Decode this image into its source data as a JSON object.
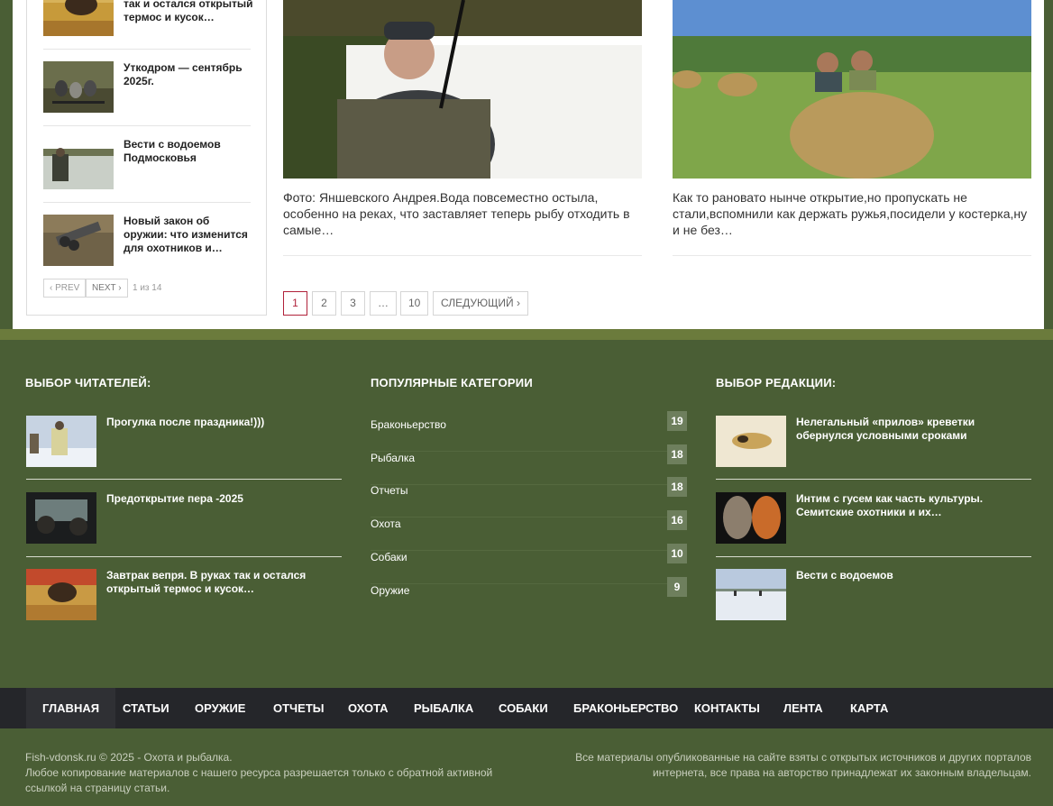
{
  "sidebar": {
    "items": [
      {
        "title": "так и остался открытый термос и кусок…"
      },
      {
        "title": "Уткодром — сентябрь 2025г."
      },
      {
        "title": "Вести с водоемов Подмосковья"
      },
      {
        "title": "Новый закон об оружии: что изменится для охотников и…"
      }
    ],
    "prev_label": "PREV",
    "next_label": "NEXT",
    "page_info": "1 из 14"
  },
  "articles": [
    {
      "excerpt": "Фото: Яншевского Андрея.Вода повсеместно остыла, особенно на реках, что заставляет теперь рыбу отходить в самые…"
    },
    {
      "excerpt": "Как то рановато нынче открытие,но пропускать не стали,вспомнили как держать ружья,посидели у костерка,ну и не без…"
    }
  ],
  "pagination": {
    "pages": [
      "1",
      "2",
      "3",
      "…",
      "10"
    ],
    "next_label": "СЛЕДУЮЩИЙ"
  },
  "footer": {
    "readers": {
      "heading": "ВЫБОР ЧИТАТЕЛЕЙ:",
      "items": [
        {
          "title": "Прогулка после праздника!)))"
        },
        {
          "title": "Предоткрытие пера -2025"
        },
        {
          "title": "Завтрак вепря. В руках так и остался открытый термос и кусок…"
        }
      ]
    },
    "categories": {
      "heading": "ПОПУЛЯРНЫЕ КАТЕГОРИИ",
      "items": [
        {
          "label": "Браконьерство",
          "count": "19"
        },
        {
          "label": "Рыбалка",
          "count": "18"
        },
        {
          "label": "Отчеты",
          "count": "18"
        },
        {
          "label": "Охота",
          "count": "16"
        },
        {
          "label": "Собаки",
          "count": "10"
        },
        {
          "label": "Оружие",
          "count": "9"
        }
      ]
    },
    "editors": {
      "heading": "ВЫБОР РЕДАКЦИИ:",
      "items": [
        {
          "title": "Нелегальный «прилов» креветки обернулся условными сроками"
        },
        {
          "title": "Интим с гусем как часть культуры. Семитские охотники и их…"
        },
        {
          "title": "Вести с водоемов"
        }
      ]
    }
  },
  "nav": {
    "items": [
      "ГЛАВНАЯ",
      "СТАТЬИ",
      "ОРУЖИЕ",
      "ОТЧЕТЫ",
      "ОХОТА",
      "РЫБАЛКА",
      "СОБАКИ",
      "БРАКОНЬЕРСТВО",
      "КОНТАКТЫ",
      "ЛЕНТА",
      "КАРТА"
    ]
  },
  "copyright": {
    "line1": "Fish-vdonsk.ru © 2025 - Охота и рыбалка.",
    "line2": "Любое копирование материалов с нашего ресурса разрешается только с обратной активной ссылкой на страницу статьи.",
    "right": "Все материалы опубликованные на сайте взяты с открытых источников и других порталов интернета, все права на авторство принадлежат их законным владельцам."
  },
  "colors": {
    "page_bg": "#4a5e35",
    "band": "#6b7b3c",
    "nav_bg": "#25262a",
    "active_page": "#b0213a",
    "count_badge": "#6e7f5d"
  }
}
